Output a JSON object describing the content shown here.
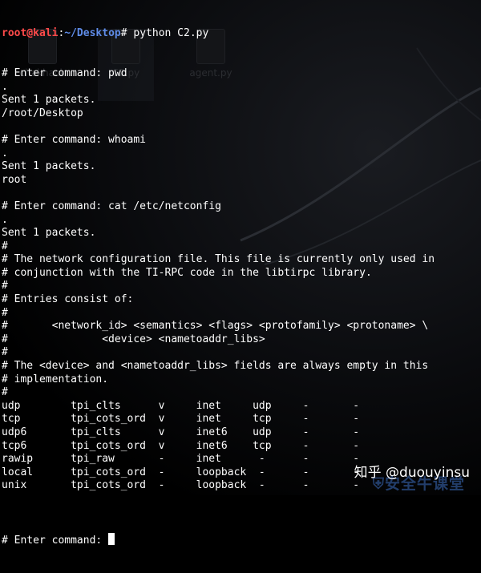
{
  "desktop": {
    "icons": [
      {
        "label": "chakhack",
        "icon": "folder-icon"
      },
      {
        "label": "C2.py",
        "icon": "python-file-icon"
      },
      {
        "label": "agent.py",
        "icon": "python-file-icon"
      }
    ]
  },
  "prompt": {
    "user_host": "root@kali",
    "colon": ":",
    "path": "~/Desktop",
    "suffix": "# ",
    "command": "python C2.py"
  },
  "output_lines": [
    "# Enter command: pwd",
    ".",
    "Sent 1 packets.",
    "/root/Desktop",
    "",
    "# Enter command: whoami",
    ".",
    "Sent 1 packets.",
    "root",
    "",
    "# Enter command: cat /etc/netconfig",
    ".",
    "Sent 1 packets.",
    "#",
    "# The network configuration file. This file is currently only used in",
    "# conjunction with the TI-RPC code in the libtirpc library.",
    "#",
    "# Entries consist of:",
    "#",
    "#       <network_id> <semantics> <flags> <protofamily> <protoname> \\",
    "#               <device> <nametoaddr_libs>",
    "#",
    "# The <device> and <nametoaddr_libs> fields are always empty in this",
    "# implementation.",
    "#",
    "udp        tpi_clts      v     inet     udp     -       -",
    "tcp        tpi_cots_ord  v     inet     tcp     -       -",
    "udp6       tpi_clts      v     inet6    udp     -       -",
    "tcp6       tpi_cots_ord  v     inet6    tcp     -       -",
    "rawip      tpi_raw       -     inet      -      -       -",
    "local      tpi_cots_ord  -     loopback  -      -       -",
    "unix       tpi_cots_ord  -     loopback  -      -       -",
    ""
  ],
  "current_prompt": "# Enter command: ",
  "watermark": {
    "text": "知乎 @duouyinsu",
    "logo_text": "安全牛课堂"
  }
}
